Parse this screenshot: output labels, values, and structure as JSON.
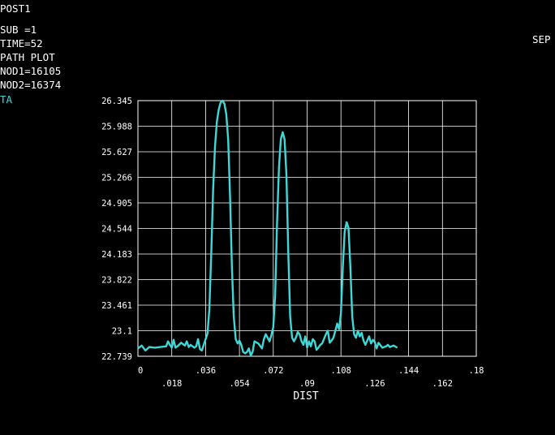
{
  "header": {
    "title": "POST1",
    "sub": "SUB =1",
    "time": "TIME=52",
    "plot_kind": "PATH PLOT",
    "nod1": "NOD1=16105",
    "nod2": "NOD2=16374",
    "series_label": "TA",
    "date_fragment": "SEP"
  },
  "colors": {
    "background": "#000000",
    "grid": "#ffffff",
    "curve": "#3fd8d8",
    "text": "#ffffff"
  },
  "chart_data": {
    "type": "line",
    "xlabel": "DIST",
    "ylabel": "",
    "xlim": [
      0,
      0.18
    ],
    "ylim": [
      22.739,
      26.345
    ],
    "x_ticks": [
      "0",
      ".018",
      ".036",
      ".054",
      ".072",
      ".09",
      ".108",
      ".126",
      ".144",
      ".162",
      ".18"
    ],
    "y_ticks": [
      "22.739",
      "23.1",
      "23.461",
      "23.822",
      "24.183",
      "24.544",
      "24.905",
      "25.266",
      "25.627",
      "25.988",
      "26.345"
    ],
    "grid": true,
    "series": [
      {
        "name": "TA",
        "x": [
          0,
          0.002,
          0.004,
          0.006,
          0.009,
          0.012,
          0.015,
          0.016,
          0.017,
          0.018,
          0.019,
          0.02,
          0.021,
          0.023,
          0.025,
          0.026,
          0.027,
          0.028,
          0.03,
          0.031,
          0.032,
          0.033,
          0.034,
          0.036,
          0.037,
          0.038,
          0.039,
          0.04,
          0.041,
          0.042,
          0.043,
          0.044,
          0.045,
          0.046,
          0.047,
          0.048,
          0.049,
          0.05,
          0.051,
          0.052,
          0.053,
          0.054,
          0.055,
          0.056,
          0.057,
          0.058,
          0.059,
          0.06,
          0.061,
          0.062,
          0.064,
          0.066,
          0.067,
          0.068,
          0.07,
          0.071,
          0.072,
          0.073,
          0.074,
          0.075,
          0.076,
          0.077,
          0.078,
          0.079,
          0.08,
          0.081,
          0.082,
          0.083,
          0.084,
          0.085,
          0.086,
          0.087,
          0.088,
          0.089,
          0.09,
          0.091,
          0.092,
          0.093,
          0.094,
          0.095,
          0.096,
          0.097,
          0.098,
          0.1,
          0.101,
          0.102,
          0.103,
          0.104,
          0.105,
          0.106,
          0.107,
          0.108,
          0.109,
          0.11,
          0.111,
          0.112,
          0.113,
          0.114,
          0.115,
          0.116,
          0.117,
          0.118,
          0.119,
          0.12,
          0.121,
          0.122,
          0.123,
          0.124,
          0.125,
          0.126,
          0.127,
          0.128,
          0.13,
          0.132,
          0.133,
          0.134,
          0.136,
          0.138
        ],
        "y": [
          22.85,
          22.89,
          22.82,
          22.87,
          22.86,
          22.87,
          22.88,
          22.95,
          22.9,
          22.86,
          22.97,
          22.86,
          22.88,
          22.93,
          22.89,
          22.95,
          22.87,
          22.9,
          22.86,
          22.88,
          22.98,
          22.84,
          22.82,
          22.98,
          23.06,
          23.4,
          24.2,
          25.1,
          25.7,
          26.05,
          26.22,
          26.32,
          26.345,
          26.3,
          26.15,
          25.8,
          25.0,
          24.0,
          23.3,
          22.98,
          22.92,
          22.96,
          22.9,
          22.8,
          22.78,
          22.8,
          22.85,
          22.75,
          22.8,
          22.95,
          22.92,
          22.85,
          22.98,
          23.05,
          22.95,
          23.04,
          23.15,
          23.6,
          24.6,
          25.4,
          25.8,
          25.9,
          25.8,
          25.3,
          24.2,
          23.3,
          23.0,
          22.95,
          23.0,
          23.08,
          23.05,
          22.95,
          22.9,
          23.02,
          22.86,
          22.95,
          22.88,
          22.98,
          22.95,
          22.83,
          22.86,
          22.9,
          22.92,
          23.05,
          23.1,
          22.93,
          22.96,
          23.0,
          23.1,
          23.2,
          23.12,
          23.35,
          24.0,
          24.5,
          24.63,
          24.55,
          24.0,
          23.3,
          23.05,
          23.0,
          23.1,
          23.02,
          23.07,
          22.96,
          22.9,
          22.96,
          23.02,
          22.92,
          22.97,
          22.94,
          22.85,
          22.93,
          22.86,
          22.88,
          22.9,
          22.87,
          22.89,
          22.86
        ]
      }
    ]
  }
}
